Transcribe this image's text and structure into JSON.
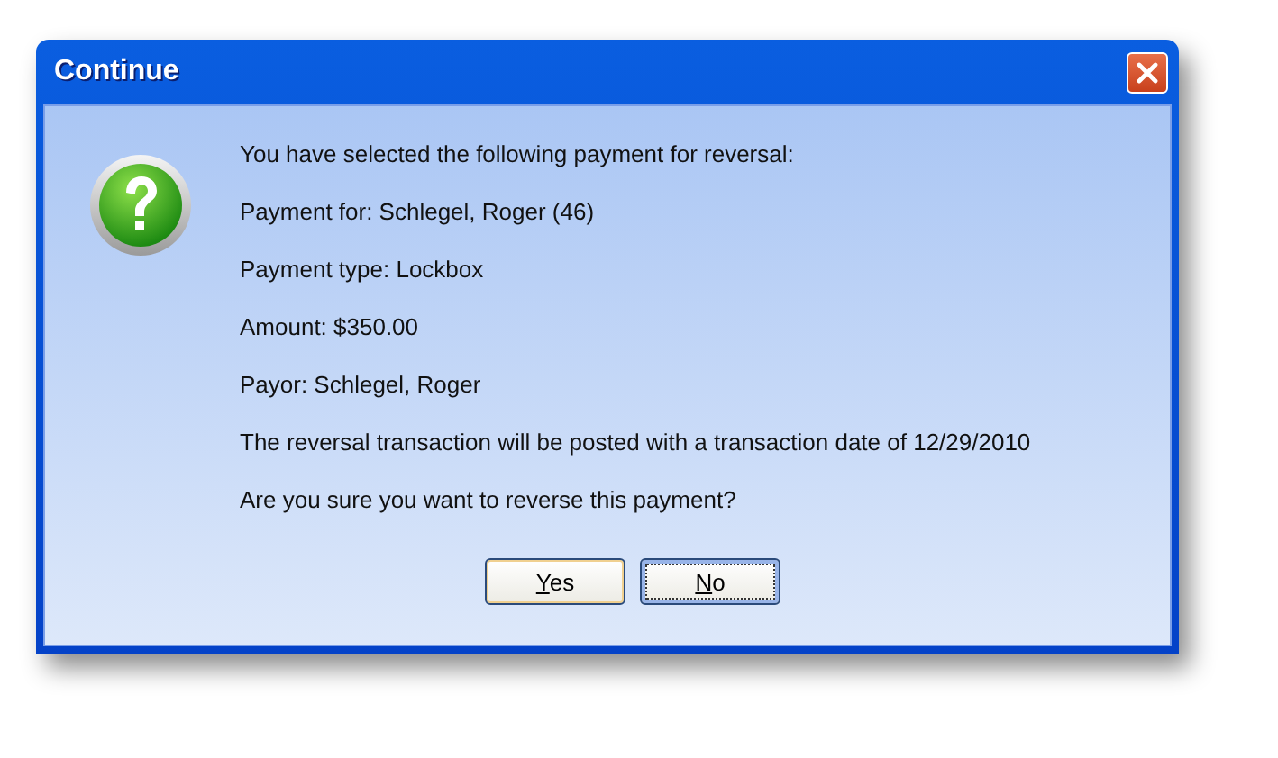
{
  "window": {
    "title": "Continue"
  },
  "message_lines": [
    "You have selected the following payment for reversal:",
    "Payment for: Schlegel, Roger (46)",
    "Payment type: Lockbox",
    "Amount: $350.00",
    "Payor: Schlegel, Roger",
    "The reversal transaction will be posted with a transaction date of 12/29/2010",
    "Are you sure you want to reverse this payment?"
  ],
  "buttons": [
    {
      "label": "Yes",
      "focused": false
    },
    {
      "label": "No",
      "focused": true
    }
  ]
}
